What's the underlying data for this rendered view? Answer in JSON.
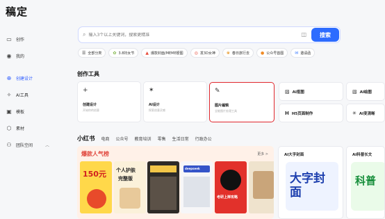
{
  "app": {
    "title": "稿定"
  },
  "sidebar": {
    "items": [
      {
        "label": "创作",
        "icon": "monitor-icon"
      },
      {
        "label": "我的",
        "icon": "user-icon"
      },
      {
        "label": "创建设计",
        "icon": "plus-circle-icon"
      },
      {
        "label": "AI工具",
        "icon": "ai-icon"
      },
      {
        "label": "模板",
        "icon": "template-icon"
      },
      {
        "label": "素材",
        "icon": "material-icon"
      },
      {
        "label": "团队空间",
        "icon": "team-icon"
      }
    ]
  },
  "search": {
    "placeholder": "输入3个以上关键词，搜索更精准",
    "button_label": "搜索"
  },
  "chips": [
    {
      "label": "全部分类",
      "icon": "menu-icon"
    },
    {
      "label": "3.8妇女节",
      "icon": "flower-icon"
    },
    {
      "label": "爆款封面/MEME梗图",
      "icon": "fire-icon"
    },
    {
      "label": "发3D女神",
      "icon": "target-icon"
    },
    {
      "label": "春日旅行去",
      "icon": "leaf-icon"
    },
    {
      "label": "公众号首图",
      "icon": "orange-icon"
    },
    {
      "label": "邀请函",
      "icon": "envelope-icon"
    }
  ],
  "create_tools": {
    "title": "创作工具",
    "large": [
      {
        "title": "创建设计",
        "subtitle": "开始你的创意",
        "icon": "plus-icon"
      },
      {
        "title": "AI设计",
        "subtitle": "探索创意灵感",
        "icon": "magic-wand-icon"
      },
      {
        "title": "图片编辑",
        "subtitle": "全能图片处理工具",
        "icon": "magic-edit-icon"
      }
    ],
    "small": [
      {
        "title": "AI抠图",
        "icon": "cutout-icon"
      },
      {
        "title": "AI绘图",
        "icon": "paint-icon"
      },
      {
        "title": "H5页面制作",
        "icon": "h5-icon"
      },
      {
        "title": "AI变清晰",
        "icon": "sparkle-icon"
      }
    ]
  },
  "category_tabs": [
    "小红书",
    "电商",
    "公众号",
    "教育培训",
    "零售",
    "生活日常",
    "行政办公"
  ],
  "banner": {
    "title": "爆款人气榜",
    "more": "更多 >",
    "thumbs": [
      "150元",
      "个人护肤",
      "完整版",
      "deepseek",
      "考研上岸攻略",
      ""
    ]
  },
  "side_cards": [
    {
      "title": "AI大字封面",
      "big": "大字封面"
    },
    {
      "title": "AI科普长文",
      "big": "科普"
    }
  ]
}
